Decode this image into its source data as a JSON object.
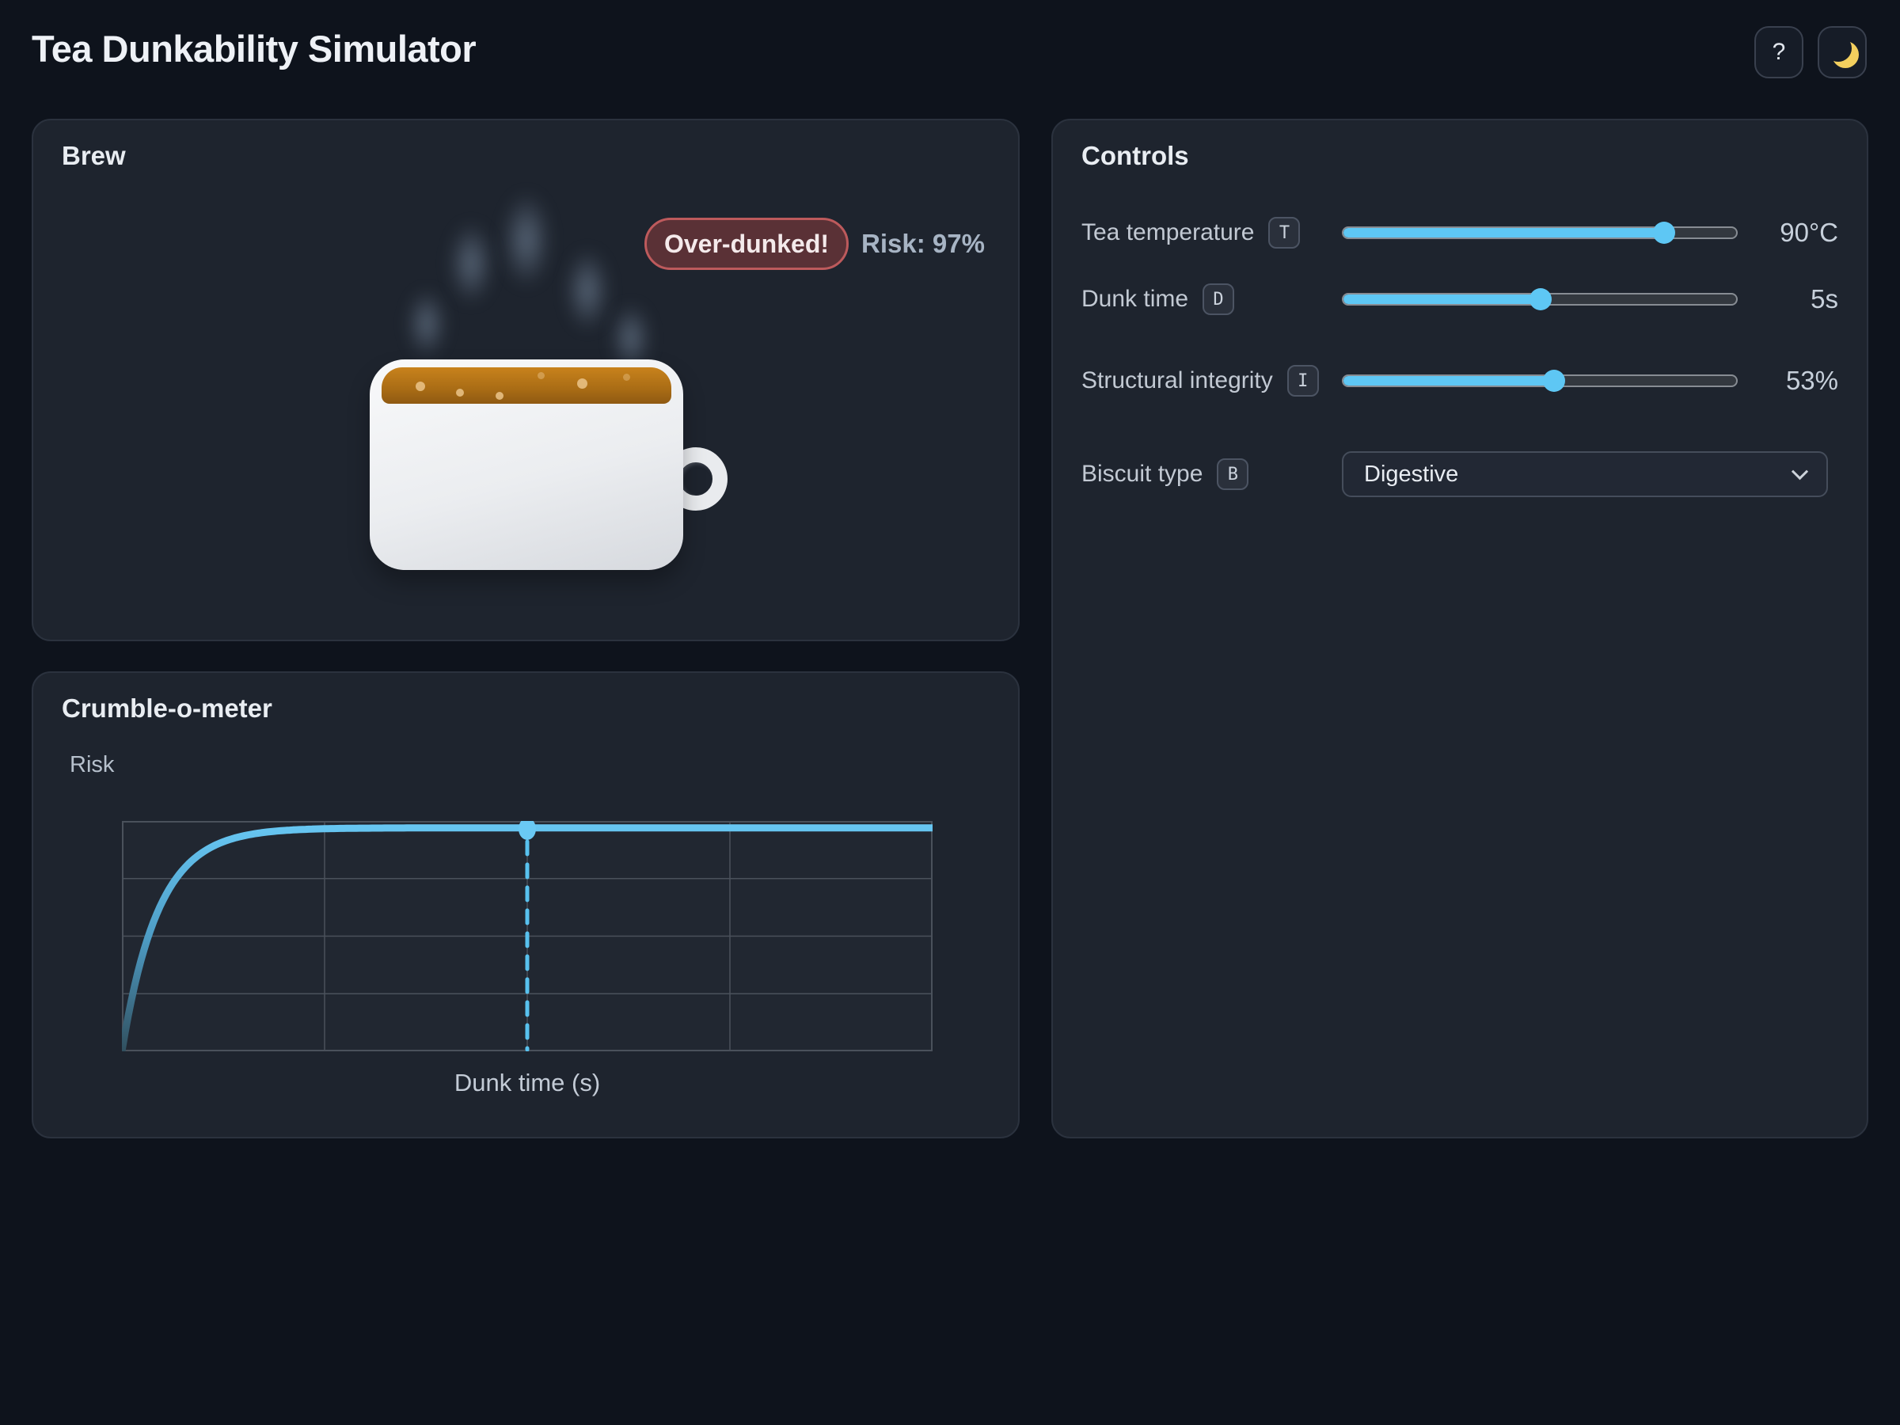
{
  "header": {
    "title": "Tea Dunkability Simulator",
    "help_button": "?",
    "theme_toggle_icon": "crescent-moon"
  },
  "brew": {
    "heading": "Brew",
    "status_badge": "Over-dunked!",
    "risk_text": "Risk: 97%"
  },
  "controls": {
    "heading": "Controls",
    "rows": [
      {
        "label": "Tea temperature",
        "shortcut": "T",
        "value": "90°C",
        "fill_pct": 81.4
      },
      {
        "label": "Dunk time",
        "shortcut": "D",
        "value": "5s",
        "fill_pct": 50.2
      },
      {
        "label": "Structural integrity",
        "shortcut": "I",
        "value": "53%",
        "fill_pct": 53.6
      }
    ],
    "biscuit": {
      "label": "Biscuit type",
      "shortcut": "B",
      "selected_option": "Digestive"
    }
  },
  "crumble": {
    "heading": "Crumble-o-meter",
    "y_axis_label": "Risk",
    "x_axis_label": "Dunk time (s)",
    "chart_data": {
      "type": "line",
      "title": "Crumble-o-meter",
      "xlabel": "Dunk time (s)",
      "ylabel": "Risk",
      "x_range_s": [
        0,
        10
      ],
      "y_range": [
        0,
        1
      ],
      "plateau_risk": 0.97,
      "rise_time_constant_s": 0.45,
      "marker_x_s": 5,
      "marker_y_risk": 0.97,
      "curve": "risk(t) = 0.97 * (1 - exp(-t / 0.45s)), saturating plateau",
      "gridlines": {
        "x_fracs": [
          0.25,
          0.5,
          0.75
        ],
        "y_fracs": [
          0.25,
          0.5,
          0.75
        ]
      },
      "legend": "none"
    }
  },
  "colors": {
    "page_bg": "#0e131c",
    "card_bg": "#1e242e",
    "accent_blue": "#5ec7f4",
    "badge_bg": "#5a3136",
    "badge_border": "#bd5a5c",
    "tea_top": "#c8821c",
    "tea_bottom": "#8f5a12",
    "grid_line": "#4a515b"
  }
}
